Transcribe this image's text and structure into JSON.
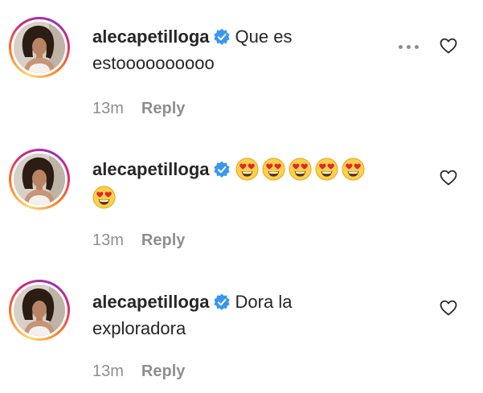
{
  "comments": [
    {
      "username": "alecapetilloga",
      "text": "Que es estoooooooooo",
      "emoji_count": 0,
      "time": "13m",
      "reply_label": "Reply",
      "verified_icon": "verified-badge-icon",
      "like_icon": "heart-outline-icon",
      "has_more_options": true
    },
    {
      "username": "alecapetilloga",
      "text": "",
      "emoji": "heart-eyes-emoji",
      "emoji_count": 6,
      "time": "13m",
      "reply_label": "Reply",
      "verified_icon": "verified-badge-icon",
      "like_icon": "heart-outline-icon",
      "has_more_options": false
    },
    {
      "username": "alecapetilloga",
      "text": "Dora la exploradora",
      "emoji_count": 0,
      "time": "13m",
      "reply_label": "Reply",
      "verified_icon": "verified-badge-icon",
      "like_icon": "heart-outline-icon",
      "has_more_options": false
    }
  ],
  "colors": {
    "verified_blue": "#3897f0",
    "muted_text": "#8e8e8e",
    "primary_text": "#262626",
    "story_ring_orange": "#fa7e1e",
    "story_ring_pink": "#d62976"
  }
}
